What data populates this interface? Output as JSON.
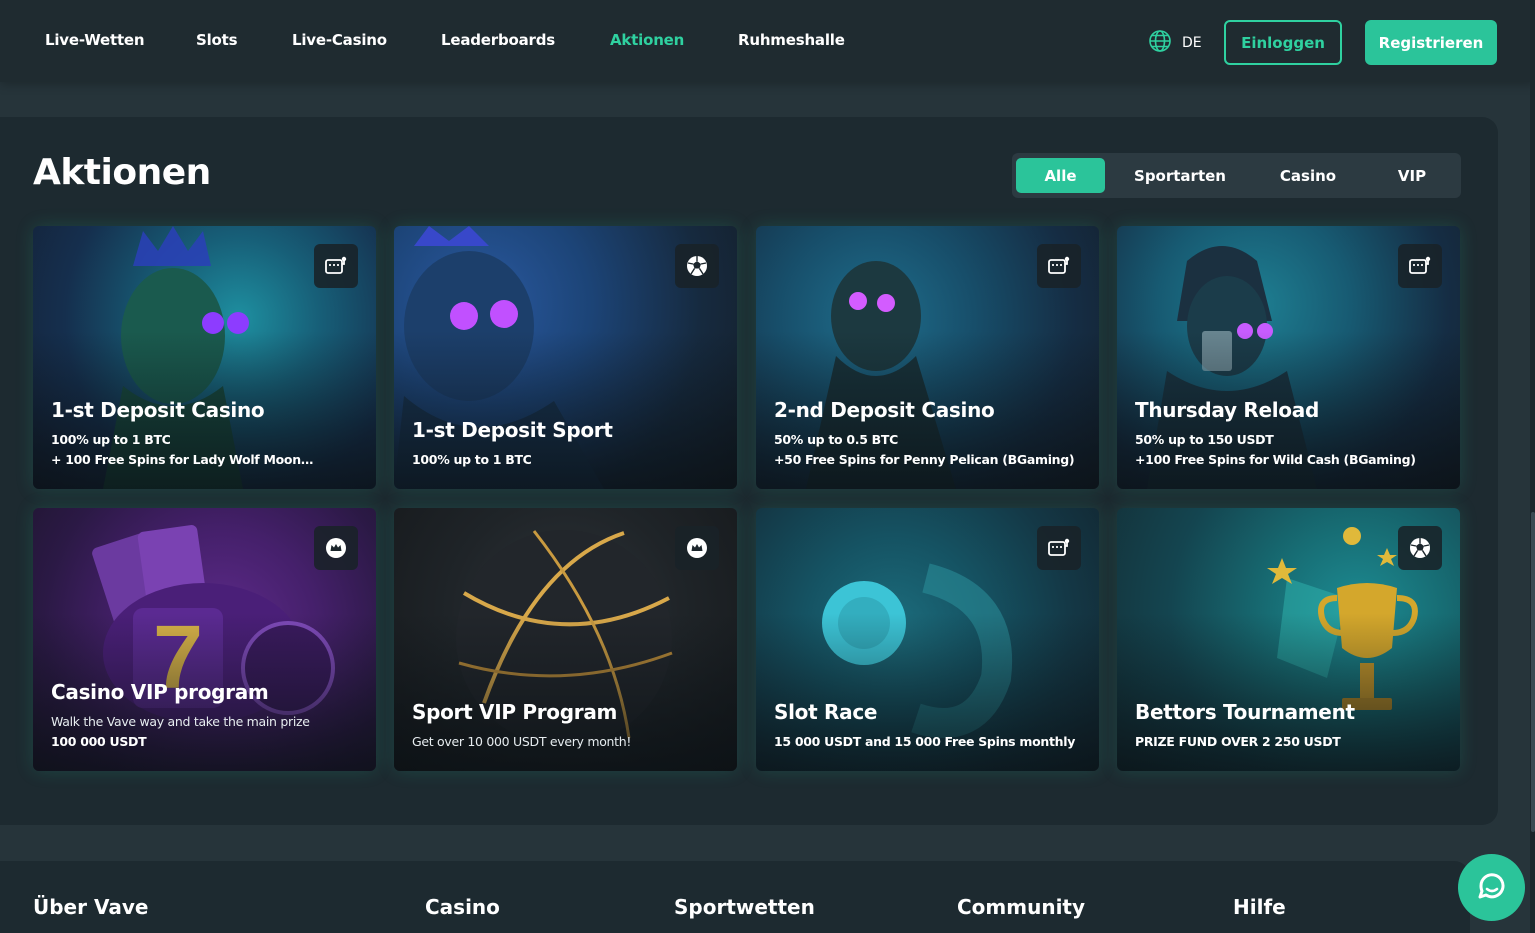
{
  "nav": {
    "items": [
      {
        "label": "Live-Wetten",
        "active": false
      },
      {
        "label": "Slots",
        "active": false
      },
      {
        "label": "Live-Casino",
        "active": false
      },
      {
        "label": "Leaderboards",
        "active": false
      },
      {
        "label": "Aktionen",
        "active": true
      },
      {
        "label": "Ruhmeshalle",
        "active": false
      }
    ],
    "language": "DE",
    "login_label": "Einloggen",
    "register_label": "Registrieren"
  },
  "page": {
    "title": "Aktionen",
    "filters": [
      {
        "label": "Alle",
        "active": true
      },
      {
        "label": "Sportarten",
        "active": false
      },
      {
        "label": "Casino",
        "active": false
      },
      {
        "label": "VIP",
        "active": false
      }
    ]
  },
  "promotions": [
    {
      "title": "1-st Deposit Casino",
      "line1": "100% up to 1 BTC",
      "line2": "+ 100 Free Spins for Lady Wolf Moon…",
      "icon": "slot-machine-icon"
    },
    {
      "title": "1-st Deposit Sport",
      "line1": "100% up to 1 BTC",
      "line2": "",
      "icon": "soccer-ball-icon"
    },
    {
      "title": "2-nd Deposit Casino",
      "line1": "50% up to 0.5 BTC",
      "line2": "+50 Free Spins for Penny Pelican (BGaming)",
      "icon": "slot-machine-icon"
    },
    {
      "title": "Thursday Reload",
      "line1": "50% up to 150 USDT",
      "line2": "+100 Free Spins for Wild Cash (BGaming)",
      "icon": "slot-machine-icon"
    },
    {
      "title": "Casino VIP program",
      "line1": "Walk the Vave way and take the main prize",
      "line2": "100 000 USDT",
      "icon": "crown-icon"
    },
    {
      "title": "Sport VIP Program",
      "line1": "Get over 10 000 USDT every month!",
      "line2": "",
      "icon": "crown-icon"
    },
    {
      "title": "Slot Race",
      "line1": "15 000 USDT and 15 000 Free Spins monthly",
      "line2": "",
      "icon": "slot-machine-icon"
    },
    {
      "title": "Bettors Tournament",
      "line1": "PRIZE FUND OVER 2 250 USDT",
      "line2": "",
      "icon": "soccer-ball-icon"
    }
  ],
  "footer": {
    "columns": [
      "Über Vave",
      "Casino",
      "Sportwetten",
      "Community",
      "Hilfe"
    ]
  },
  "colors": {
    "accent": "#2bc49a",
    "background": "#26343a",
    "panel": "#1d2a30"
  }
}
